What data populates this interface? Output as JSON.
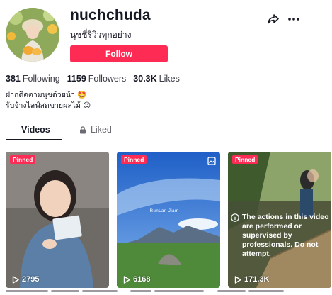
{
  "profile": {
    "username": "nuchchuda",
    "nickname": "นุชชี่รีวิวทุกอย่าง",
    "follow_label": "Follow"
  },
  "header_icons": {
    "share": "share-icon",
    "more": "more-icon"
  },
  "stats": {
    "following_count": "381",
    "following_label": "Following",
    "followers_count": "1159",
    "followers_label": "Followers",
    "likes_count": "30.3K",
    "likes_label": "Likes"
  },
  "bio": {
    "line1": "ฝากติดตามนุชด้วยน้า 🤩",
    "line2": "รับจ้างไลฟ์สดขายผลไม้ 😍"
  },
  "tabs": [
    {
      "label": "Videos",
      "active": true
    },
    {
      "label": "Liked",
      "active": false,
      "icon": "lock-icon"
    }
  ],
  "videos": [
    {
      "badge": "Pinned",
      "views": "2795"
    },
    {
      "badge": "Pinned",
      "views": "6168",
      "overlay_text": "· RunLan Jiam ·"
    },
    {
      "badge": "Pinned",
      "views": "171.3K",
      "notice": "The actions in this video are performed or supervised by professionals. Do not attempt."
    }
  ],
  "colors": {
    "accent": "#fe2c55",
    "text": "#161823"
  }
}
